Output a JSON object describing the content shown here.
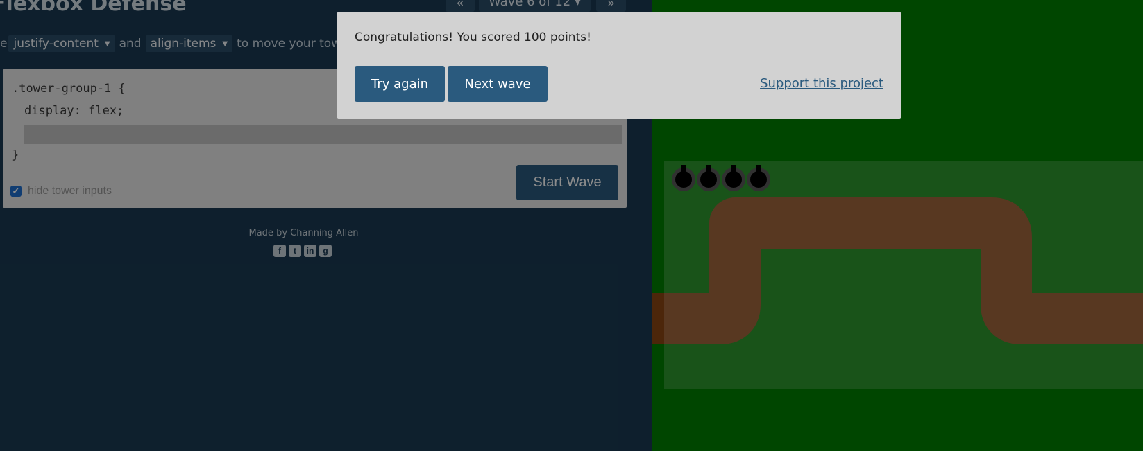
{
  "app": {
    "title": "Flexbox Defense"
  },
  "nav": {
    "prev_label": "«",
    "level_label": "Wave 6 of 12 ▾",
    "next_label": "»"
  },
  "instructions": {
    "lead": "e",
    "dropdown1": "justify-content",
    "and_text": "and",
    "dropdown2": "align-items",
    "tail": "to move your tow"
  },
  "editor": {
    "line1": ".tower-group-1 {",
    "line2": "display: flex;",
    "input_value": "",
    "closing": "}",
    "hide_inputs_label": "hide tower inputs",
    "hide_inputs_checked": true,
    "start_wave_label": "Start Wave"
  },
  "footer": {
    "credit": "Made by Channing Allen",
    "socials": [
      "facebook-icon",
      "twitter-icon",
      "linkedin-icon",
      "github-icon"
    ]
  },
  "board": {
    "grass_color": "#008000",
    "path_color": "#8b4513",
    "tower_count": 4
  },
  "modal": {
    "message": "Congratulations! You scored 100 points!",
    "try_again_label": "Try again",
    "next_wave_label": "Next wave",
    "support_label": "Support this project"
  },
  "colors": {
    "button": "#2a5a7e",
    "panel_bg": "#1a3a52",
    "modal_bg": "#d2d2d2"
  }
}
